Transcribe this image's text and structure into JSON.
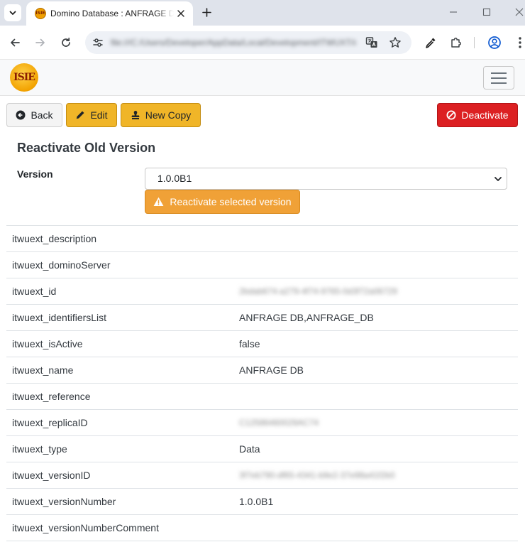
{
  "browser": {
    "tab_title": "Domino Database : ANFRAGE DB",
    "url": "file:///C:/Users/Developer/AppData/Local/Development/ITWUXT/index.html",
    "favicon_text": "ISIE"
  },
  "app": {
    "logo_text": "ISIE",
    "buttons": {
      "back": "Back",
      "edit": "Edit",
      "new_copy": "New Copy",
      "deactivate": "Deactivate"
    },
    "reactivate": {
      "title": "Reactivate Old Version",
      "version_label": "Version",
      "selected_version": "1.0.0B1",
      "button": "Reactivate selected version"
    },
    "properties": [
      {
        "key": "itwuext_description",
        "value": ""
      },
      {
        "key": "itwuext_dominoServer",
        "value": ""
      },
      {
        "key": "itwuext_id",
        "value": "2bdab674-a279-4f74-9765-0d3f72a06729"
      },
      {
        "key": "itwuext_identifiersList",
        "value": "ANFRAGE DB,ANFRAGE_DB"
      },
      {
        "key": "itwuext_isActive",
        "value": "false"
      },
      {
        "key": "itwuext_name",
        "value": "ANFRAGE DB"
      },
      {
        "key": "itwuext_reference",
        "value": ""
      },
      {
        "key": "itwuext_replicaID",
        "value": "C12586460029AC74"
      },
      {
        "key": "itwuext_type",
        "value": "Data"
      },
      {
        "key": "itwuext_versionID",
        "value": "3f7eb790-df65-4341-b9e2-37e98a41f2b0"
      },
      {
        "key": "itwuext_versionNumber",
        "value": "1.0.0B1"
      },
      {
        "key": "itwuext_versionNumberComment",
        "value": ""
      }
    ]
  }
}
